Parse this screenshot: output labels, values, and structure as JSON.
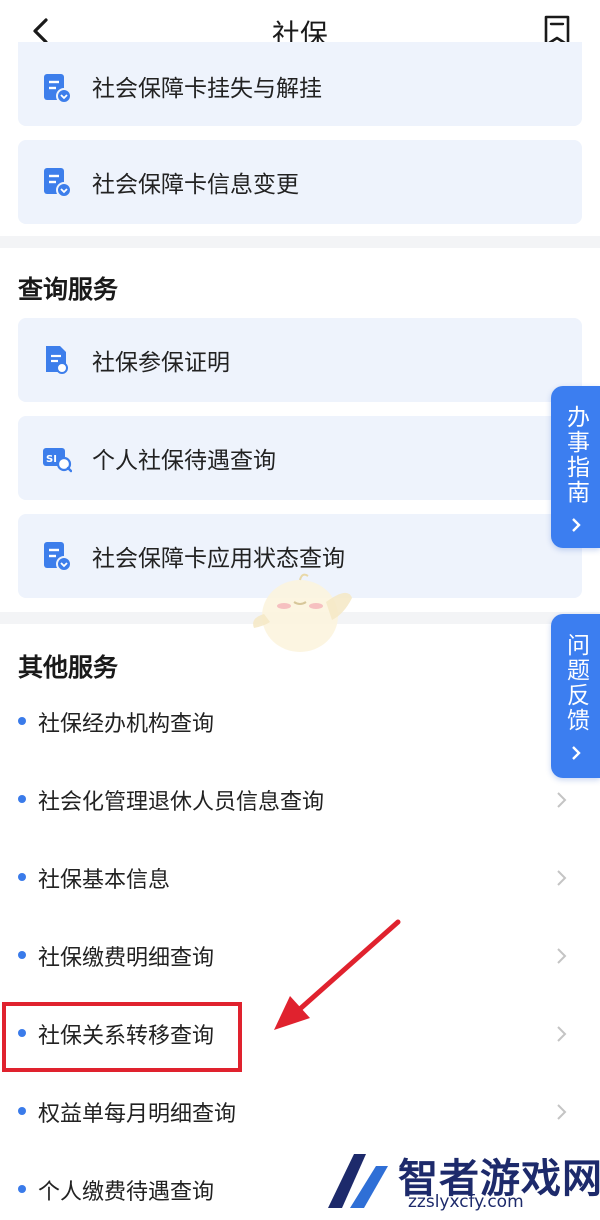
{
  "header": {
    "title": "社保"
  },
  "cards_top": [
    {
      "label": "社会保障卡挂失与解挂",
      "icon": "document-download-icon"
    },
    {
      "label": "社会保障卡信息变更",
      "icon": "document-download-icon"
    }
  ],
  "query_section": {
    "title": "查询服务",
    "items": [
      {
        "label": "社保参保证明",
        "icon": "certificate-icon"
      },
      {
        "label": "个人社保待遇查询",
        "icon": "si-search-icon"
      },
      {
        "label": "社会保障卡应用状态查询",
        "icon": "document-download-icon"
      }
    ]
  },
  "other_section": {
    "title": "其他服务",
    "items": [
      {
        "label": "社保经办机构查询"
      },
      {
        "label": "社会化管理退休人员信息查询"
      },
      {
        "label": "社保基本信息"
      },
      {
        "label": "社保缴费明细查询"
      },
      {
        "label": "社保关系转移查询"
      },
      {
        "label": "权益单每月明细查询"
      },
      {
        "label": "个人缴费待遇查询"
      }
    ]
  },
  "side_tabs": {
    "guide": {
      "label": "办事指南"
    },
    "feedback": {
      "label": "问题反馈"
    }
  },
  "watermark": {
    "name": "智者游戏网",
    "url": "zzslyxcfy.com"
  },
  "colors": {
    "accent": "#3c7ef0",
    "card_bg": "#eef3fc",
    "highlight": "#e0222e"
  }
}
